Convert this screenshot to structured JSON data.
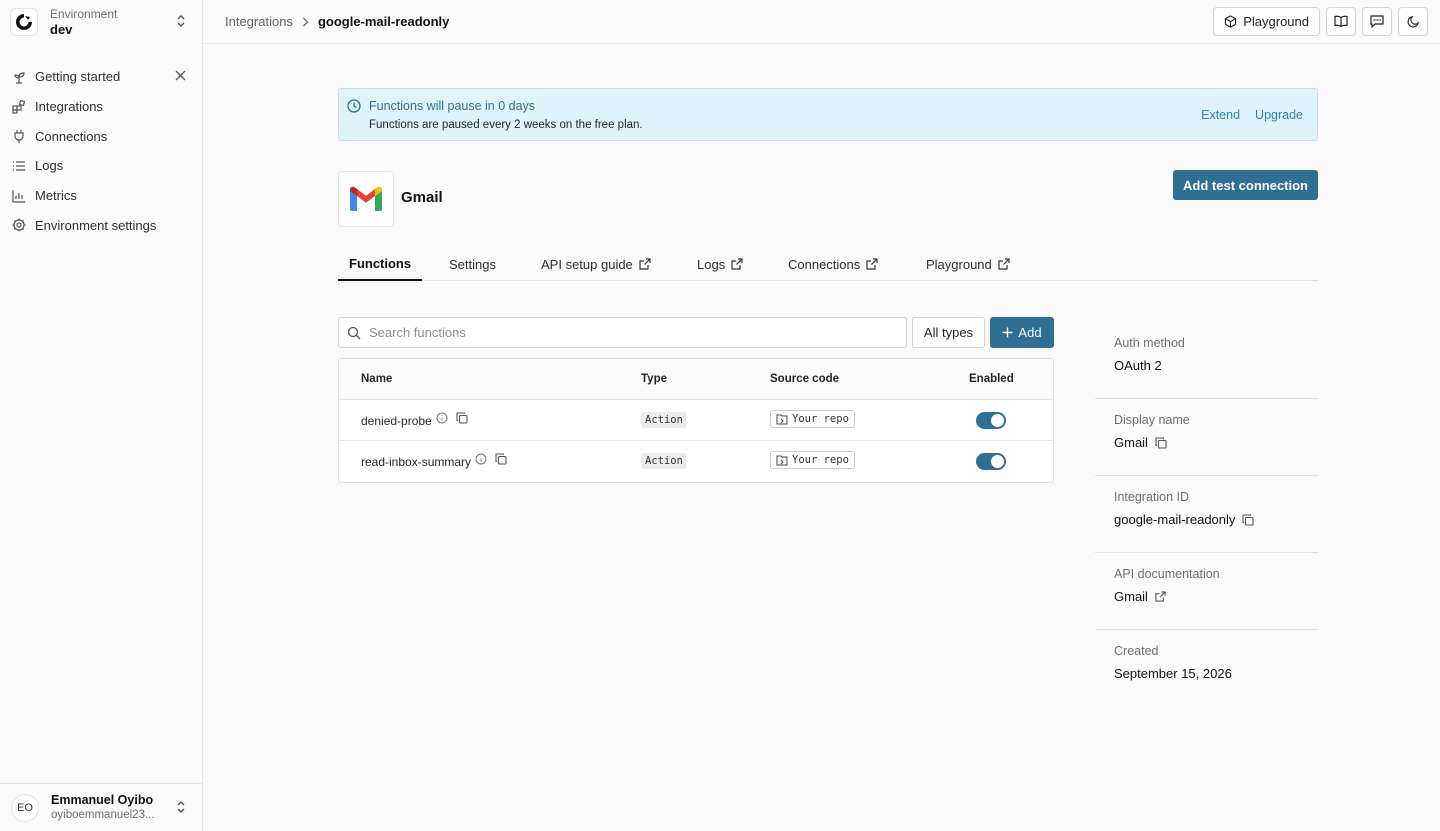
{
  "sidebar": {
    "environment_label": "Environment",
    "environment_value": "dev",
    "items": [
      {
        "label": "Getting started",
        "icon": "sprout-icon"
      },
      {
        "label": "Integrations",
        "icon": "blocks-icon"
      },
      {
        "label": "Connections",
        "icon": "plug-icon"
      },
      {
        "label": "Logs",
        "icon": "list-icon"
      },
      {
        "label": "Metrics",
        "icon": "chart-icon"
      },
      {
        "label": "Environment settings",
        "icon": "gear-icon"
      }
    ],
    "user": {
      "initials": "EO",
      "name": "Emmanuel Oyibo",
      "email": "oyiboemmanuel23..."
    }
  },
  "topbar": {
    "breadcrumb_parent": "Integrations",
    "breadcrumb_current": "google-mail-readonly",
    "playground_label": "Playground"
  },
  "banner": {
    "title": "Functions will pause in 0 days",
    "subtitle": "Functions are paused every 2 weeks on the free plan.",
    "extend_label": "Extend",
    "upgrade_label": "Upgrade"
  },
  "integration": {
    "title": "Gmail",
    "add_test_connection_label": "Add test connection"
  },
  "tabs": [
    {
      "label": "Functions",
      "external": false
    },
    {
      "label": "Settings",
      "external": false
    },
    {
      "label": "API setup guide",
      "external": true
    },
    {
      "label": "Logs",
      "external": true
    },
    {
      "label": "Connections",
      "external": true
    },
    {
      "label": "Playground",
      "external": true
    }
  ],
  "functions": {
    "search_placeholder": "Search functions",
    "types_label": "All types",
    "add_label": "Add",
    "columns": [
      "Name",
      "Type",
      "Source code",
      "Enabled"
    ],
    "rows": [
      {
        "name": "denied-probe",
        "type": "Action",
        "source": "Your repo",
        "enabled": true
      },
      {
        "name": "read-inbox-summary",
        "type": "Action",
        "source": "Your repo",
        "enabled": true
      }
    ]
  },
  "details": [
    {
      "label": "Auth method",
      "value": "OAuth 2",
      "icon": ""
    },
    {
      "label": "Display name",
      "value": "Gmail",
      "icon": "copy-icon"
    },
    {
      "label": "Integration ID",
      "value": "google-mail-readonly",
      "icon": "copy-icon"
    },
    {
      "label": "API documentation",
      "value": "Gmail",
      "icon": "external-link-icon"
    },
    {
      "label": "Created",
      "value": "September 15, 2026",
      "icon": ""
    }
  ],
  "colors": {
    "accent": "#2e6f93",
    "banner_bg": "#dff3fb",
    "banner_text": "#2f6f8f"
  }
}
